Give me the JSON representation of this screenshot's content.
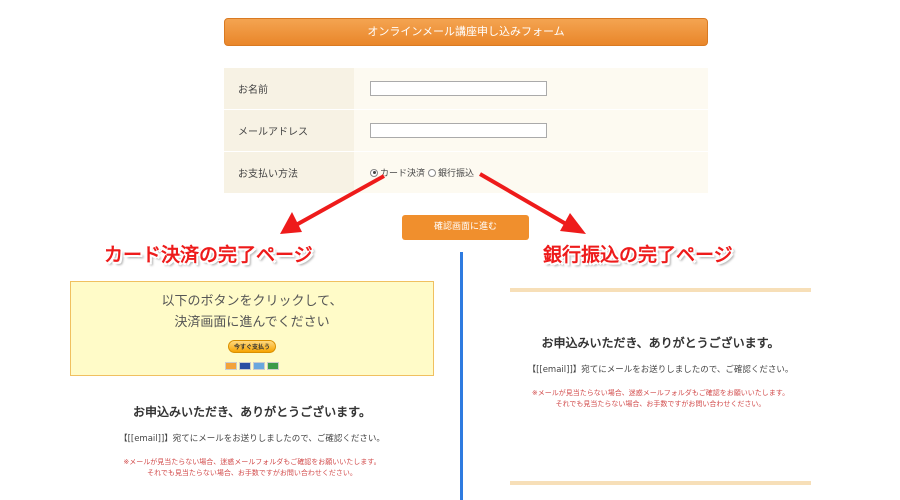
{
  "form": {
    "title": "オンラインメール講座申し込みフォーム",
    "fields": [
      {
        "label": "お名前",
        "value": ""
      },
      {
        "label": "メールアドレス",
        "value": ""
      }
    ],
    "payment": {
      "label": "お支払い方法",
      "options": [
        {
          "label": "カード決済",
          "checked": true
        },
        {
          "label": "銀行振込",
          "checked": false
        }
      ]
    },
    "confirm_button": "確認画面に進む"
  },
  "annotations": {
    "card_heading": "カード決済の完了ページ",
    "bank_heading": "銀行振込の完了ページ",
    "arrow_color": "#ee1b1b",
    "divider_color": "#2e7be0"
  },
  "card_page": {
    "box_line1": "以下のボタンをクリックして、",
    "box_line2": "決済画面に進んでください",
    "paynow_label": "今すぐ支払う",
    "thanks": "お申込みいただき、ありがとうございます。",
    "email_line": "【[[email]]】宛てにメールをお送りしましたので、ご確認ください。",
    "notice_line1": "※メールが見当たらない場合、迷惑メールフォルダもご確認をお願いいたします。",
    "notice_line2": "それでも見当たらない場合、お手数ですがお問い合わせください。"
  },
  "bank_page": {
    "thanks": "お申込みいただき、ありがとうございます。",
    "email_line": "【[[email]]】宛てにメールをお送りしましたので、ご確認ください。",
    "notice_line1": "※メールが見当たらない場合、迷惑メールフォルダもご確認をお願いいたします。",
    "notice_line2": "それでも見当たらない場合、お手数ですがお問い合わせください。"
  }
}
